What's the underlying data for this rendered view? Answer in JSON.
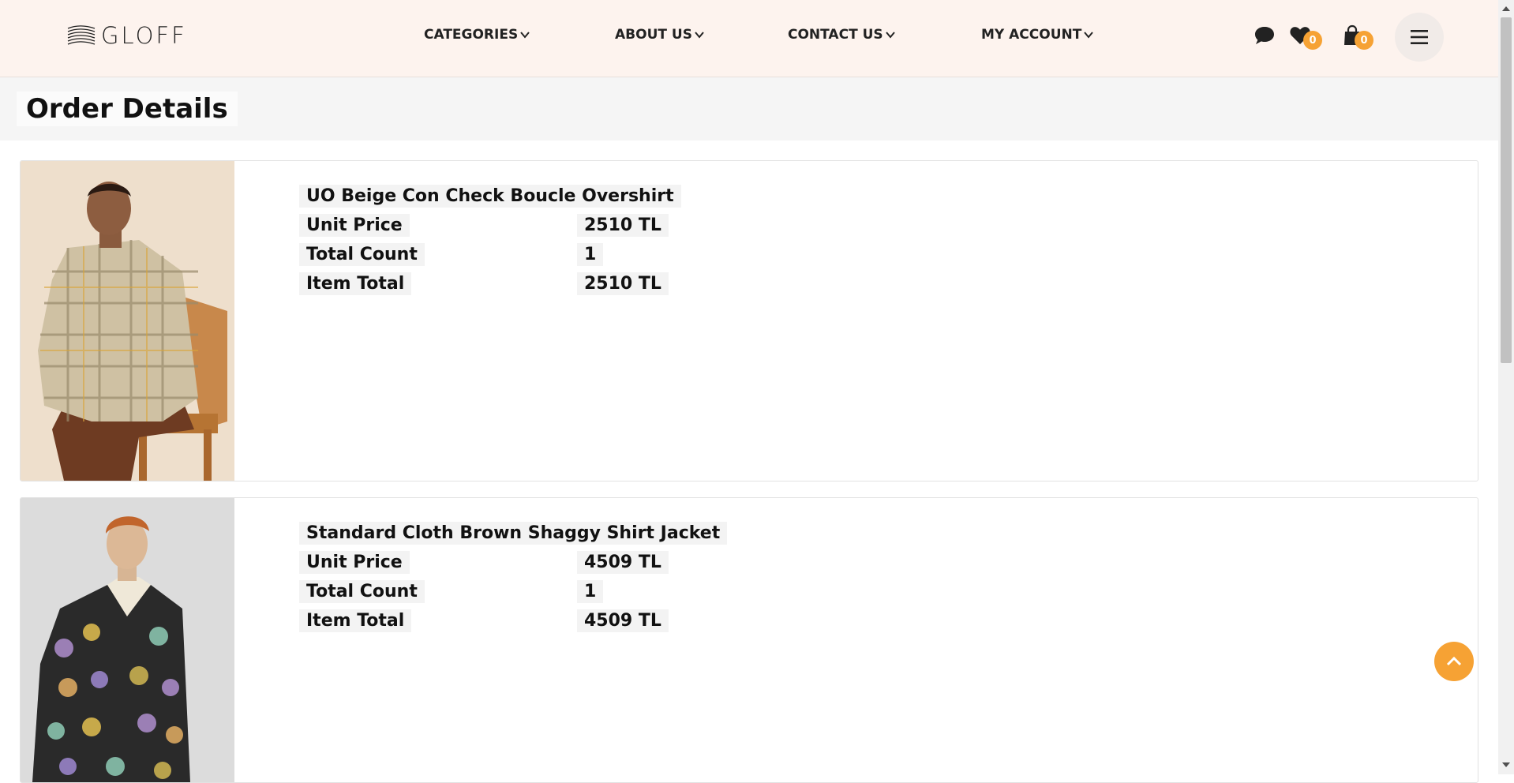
{
  "header": {
    "logo_text": "GLOFF",
    "nav": [
      {
        "label": "CATEGORIES"
      },
      {
        "label": "ABOUT US"
      },
      {
        "label": "CONTACT US"
      },
      {
        "label": "MY ACCOUNT"
      }
    ],
    "icons": {
      "chat": "chat-bubble-icon",
      "wishlist": "heart-icon",
      "cart": "shopping-bag-icon",
      "menu": "hamburger-menu-icon"
    },
    "wishlist_count": "0",
    "cart_count": "0"
  },
  "page": {
    "title": "Order Details"
  },
  "orders": [
    {
      "name": "UO Beige Con Check Boucle Overshirt",
      "unit_price_label": "Unit Price",
      "unit_price": "2510 TL",
      "count_label": "Total Count",
      "count": "1",
      "total_label": "Item Total",
      "total": "2510 TL"
    },
    {
      "name": "Standard Cloth Brown Shaggy Shirt Jacket",
      "unit_price_label": "Unit Price",
      "unit_price": "4509 TL",
      "count_label": "Total Count",
      "count": "1",
      "total_label": "Item Total",
      "total": "4509 TL"
    }
  ],
  "colors": {
    "accent": "#f6a234",
    "header_bg": "#fdf3ee"
  }
}
